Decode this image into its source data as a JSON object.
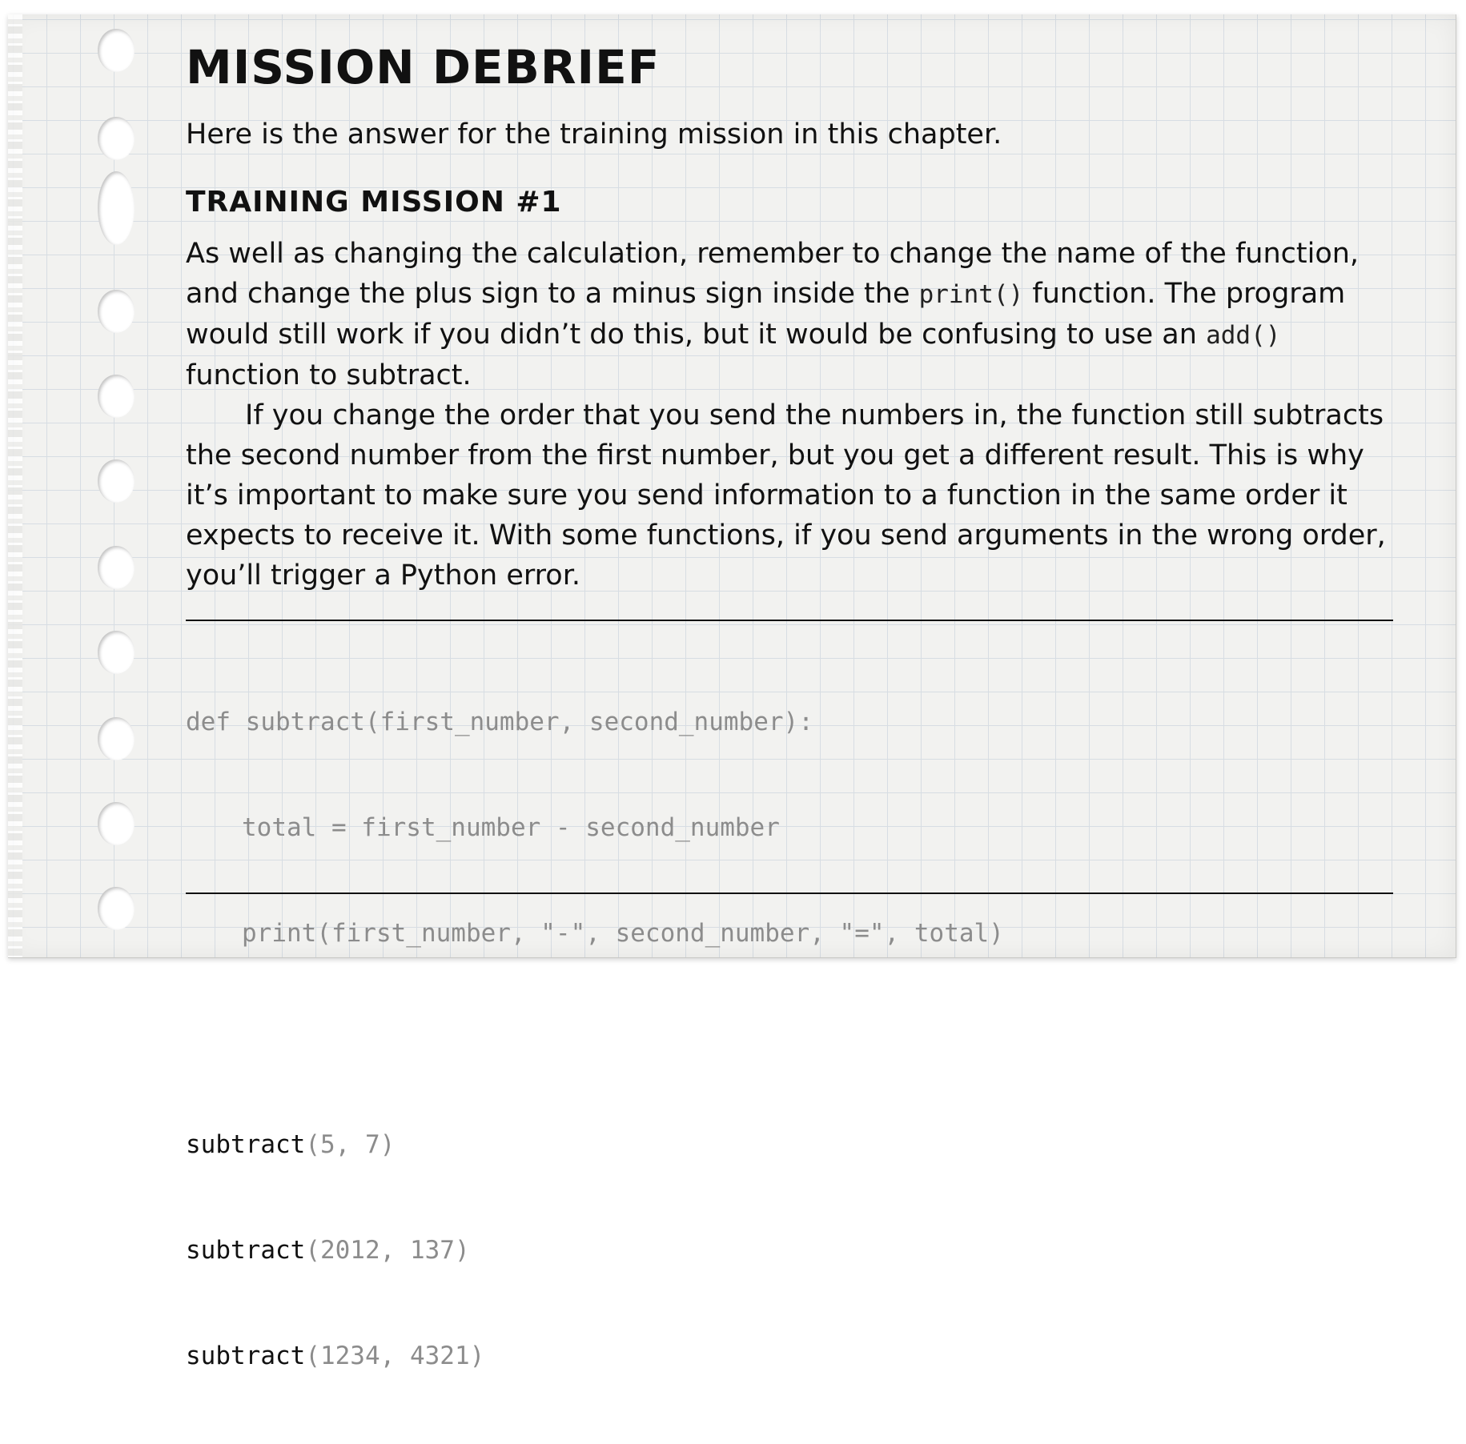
{
  "title": "MISSION DEBRIEF",
  "intro": "Here is the answer for the training mission in this chapter.",
  "subheading": "TRAINING MISSION #1",
  "paragraph1": {
    "part1": "As well as changing the calculation, remember to change the name of the function, and change the plus sign to a minus sign inside the ",
    "code1": "print()",
    "part2": " function. The program would still work if you didn’t do this, but it would be confusing to use an ",
    "code2": "add()",
    "part3": " function to subtract."
  },
  "paragraph2": "If you change the order that you send the numbers in, the function still subtracts the second number from the first number, but you get a different result. This is why it’s important to make sure you send information to a function in the same order it expects to receive it. With some functions, if you send arguments in the wrong order, you’ll trigger a Python error.",
  "code": {
    "def_line": "def subtract(first_number, second_number):",
    "body_line1": "total = first_number - second_number",
    "body_line2": "print(first_number, \"-\", second_number, \"=\", total)",
    "calls": [
      {
        "name": "subtract",
        "args": "(5, 7)"
      },
      {
        "name": "subtract",
        "args": "(2012, 137)"
      },
      {
        "name": "subtract",
        "args": "(1234, 4321)"
      }
    ]
  }
}
